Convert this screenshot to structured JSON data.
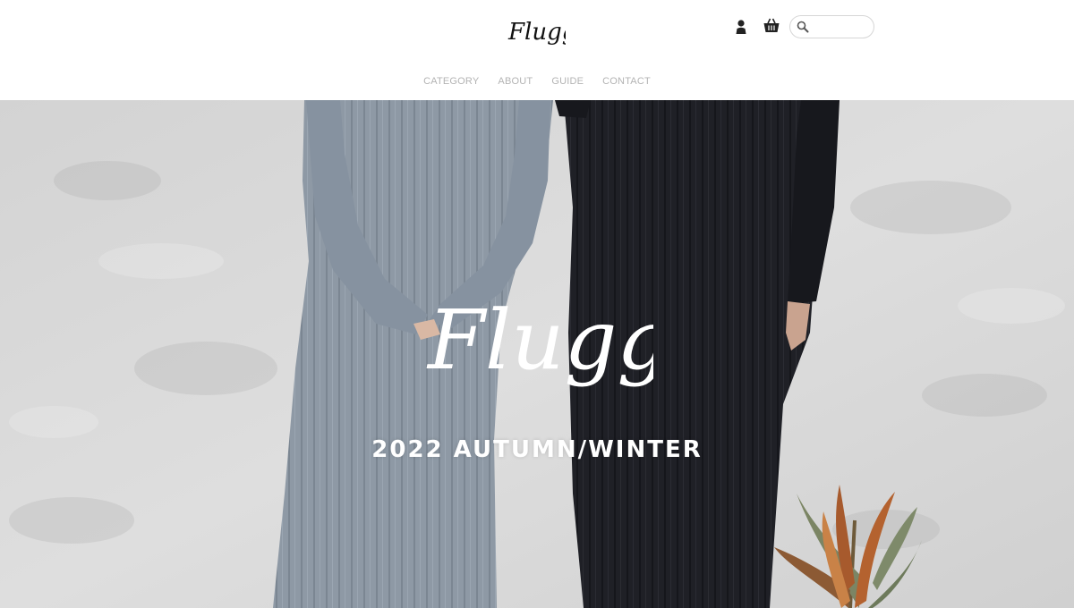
{
  "header": {
    "logo_text": "Flugge",
    "icons": {
      "account": "user-icon",
      "cart": "basket-icon",
      "search": "search-icon"
    },
    "search": {
      "value": "",
      "placeholder": ""
    }
  },
  "nav": {
    "items": [
      {
        "label": "CATEGORY"
      },
      {
        "label": "ABOUT"
      },
      {
        "label": "GUIDE"
      },
      {
        "label": "CONTACT"
      }
    ]
  },
  "hero": {
    "logo_text": "Flugge",
    "tagline": "2022 AUTUMN/WINTER"
  },
  "colors": {
    "nav_text": "#b3b3b3",
    "header_bg": "#ffffff",
    "hero_wall": "#dcdcdc",
    "grey_dress": "#8f9aa6",
    "black_dress": "#1e1f24",
    "hero_text": "#ffffff"
  }
}
